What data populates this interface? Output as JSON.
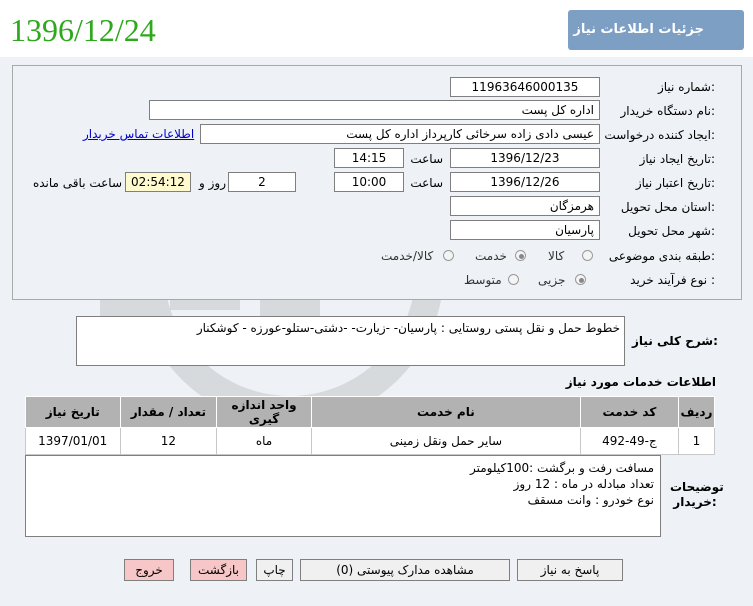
{
  "header": {
    "title": "جزئیات اطلاعات نیاز",
    "date": "1396/12/24"
  },
  "fields": {
    "need_number": {
      "label": "شماره نیاز:",
      "value": "11963646000135"
    },
    "buyer_org": {
      "label": "نام دستگاه خریدار:",
      "value": "اداره کل پست"
    },
    "requester": {
      "label": "ایجاد کننده درخواست:",
      "value": "عیسی دادی زاده سرخائی کارپرداز اداره کل پست",
      "contact_link": "اطلاعات تماس خریدار"
    },
    "created": {
      "label": "تاریخ ایجاد نیاز:",
      "date": "1396/12/23",
      "time_label": "ساعت",
      "time": "14:15"
    },
    "validity": {
      "label": "تاریخ اعتبار نیاز:",
      "date": "1396/12/26",
      "time_label": "ساعت",
      "time": "10:00",
      "days": "2",
      "days_label": "روز و",
      "remaining": "02:54:12",
      "remaining_label": "ساعت باقی مانده"
    },
    "province": {
      "label": "استان محل تحویل:",
      "value": "هرمزگان"
    },
    "city": {
      "label": "شهر محل تحویل:",
      "value": "پارسیان"
    },
    "category": {
      "label": "طبقه بندی موضوعی:",
      "options": [
        "کالا",
        "خدمت",
        "کالا/خدمت"
      ],
      "selected": "خدمت"
    },
    "purchase_type": {
      "label": "نوع فرآیند خرید :",
      "options": [
        "جزیی",
        "متوسط"
      ],
      "selected": "جزیی"
    }
  },
  "summary": {
    "label": "شرح کلی نیاز:",
    "value": "خطوط حمل و نقل پستی  روستایی : پارسیان- -زیارت- -دشتی-ستلو-عورزه - کوشکنار"
  },
  "services": {
    "section_title": "اطلاعات خدمات مورد نیاز",
    "columns": [
      "ردیف",
      "کد خدمت",
      "نام خدمت",
      "واحد اندازه گیری",
      "تعداد / مقدار",
      "تاریخ نیاز"
    ],
    "rows": [
      [
        "1",
        "ج-49-492",
        "سایر حمل ونقل زمینی",
        "ماه",
        "12",
        "1397/01/01"
      ]
    ]
  },
  "notes": {
    "label": "توضیحات خریدار:",
    "lines": [
      "مسافت رفت و برگشت :100کیلومتر",
      "تعداد مبادله در ماه : 12 روز",
      "نوع خودرو : وانت مسقف"
    ]
  },
  "buttons": {
    "reply": "پاسخ به نیاز",
    "attachments": "مشاهده مدارک پیوستی (0)",
    "print": "چاپ",
    "back": "بازگشت",
    "exit": "خروج"
  },
  "colors": {
    "title_bar": "#7d9fc4",
    "date": "#2ea81d",
    "table_header": "#b2b2b2",
    "remaining_bg": "#fffacd"
  }
}
